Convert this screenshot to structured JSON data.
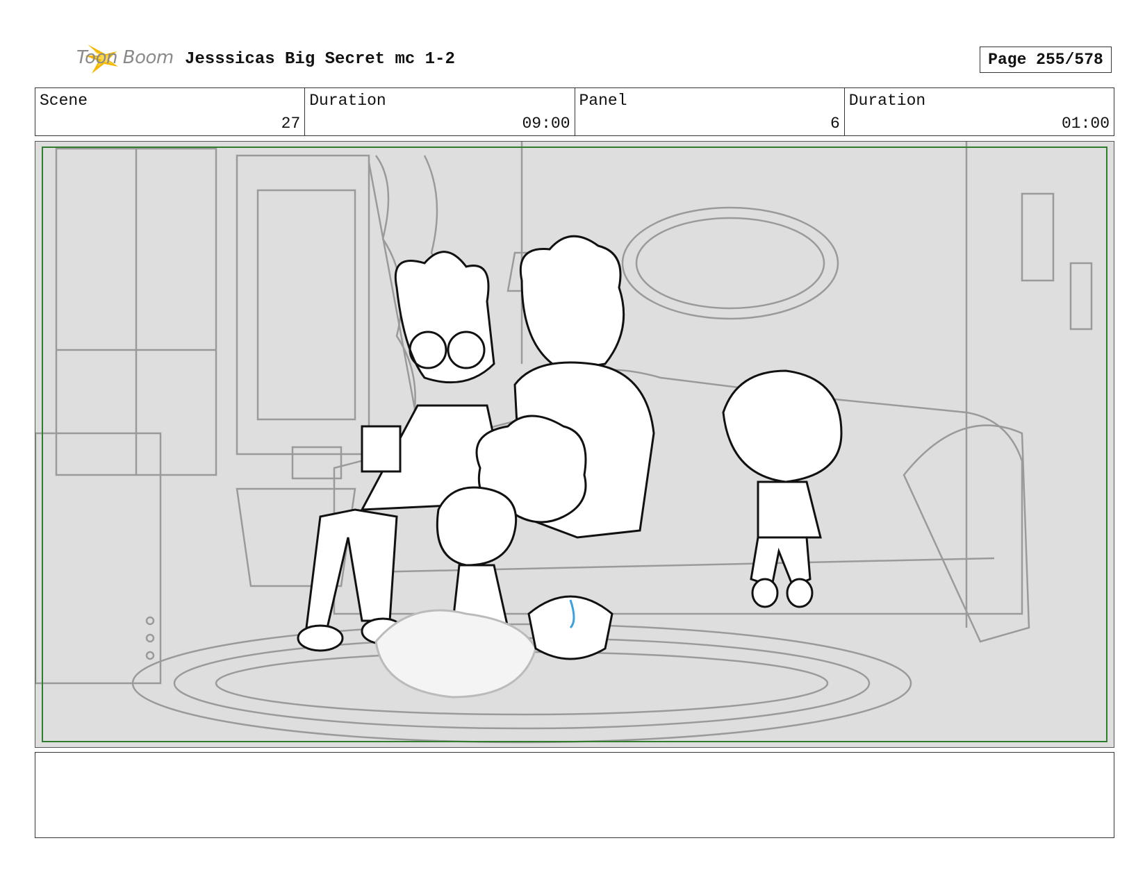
{
  "header": {
    "logo_text": "Toon Boom",
    "title": "Jesssicas Big Secret mc 1-2",
    "page": "Page 255/578"
  },
  "info": {
    "scene_label": "Scene",
    "scene_value": "27",
    "duration_label": "Duration",
    "duration_value": "09:00",
    "panel_label": "Panel",
    "panel_value": "6",
    "panel_duration_label": "Duration",
    "panel_duration_value": "01:00"
  },
  "notes": {
    "text": ""
  },
  "colors": {
    "logo_accent": "#f5b800",
    "safe_frame": "#2e7d2e",
    "sketch_background": "#dedede",
    "popcorn_accent": "#3aa0e0"
  }
}
